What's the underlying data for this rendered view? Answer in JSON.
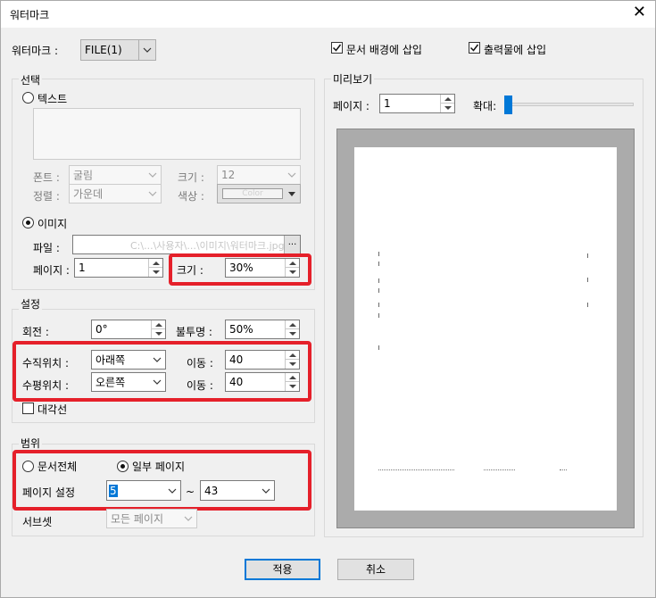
{
  "window": {
    "title": "워터마크",
    "close": "✕"
  },
  "watermark": {
    "label": "워터마크 :",
    "value": "FILE(1)"
  },
  "options": {
    "behind_text": "문서 배경에 삽입",
    "on_print": "출력물에 삽입",
    "behind_text_checked": true,
    "on_print_checked": true
  },
  "selection": {
    "title": "선택",
    "text_radio": "텍스트",
    "text_selected": false,
    "font_label": "폰트 :",
    "font_value": "굴림",
    "size_label": "크기 :",
    "size_value": "12",
    "align_label": "정렬 :",
    "align_value": "가운데",
    "color_label": "색상 :",
    "color_value": "Color",
    "image_radio": "이미지",
    "image_selected": true,
    "file_label": "파일 :",
    "file_value": "C:\\...\\사용자\\...\\이미지\\워터마크.jpg",
    "browse": "...",
    "page_label": "페이지 :",
    "page_value": "1",
    "scale_label": "크기 :",
    "scale_value": "30%"
  },
  "settings": {
    "title": "설정",
    "rotation_label": "회전 :",
    "rotation_value": "0°",
    "opacity_label": "불투명 :",
    "opacity_value": "50%",
    "vertical_label": "수직위치 :",
    "vertical_value": "아래쪽",
    "vshift_label": "이동 :",
    "vshift_value": "40",
    "horizontal_label": "수평위치 :",
    "horizontal_value": "오른쪽",
    "hshift_label": "이동 :",
    "hshift_value": "40",
    "diagonal_label": "대각선",
    "diagonal_checked": false
  },
  "range": {
    "title": "범위",
    "all_radio": "문서전체",
    "partial_radio": "일부 페이지",
    "partial_selected": true,
    "page_setting_label": "페이지 설정",
    "from_value": "5",
    "tilde": "~",
    "to_value": "43",
    "subset_label": "서브셋",
    "subset_value": "모든 페이지"
  },
  "preview": {
    "title": "미리보기",
    "page_label": "페이지 :",
    "page_value": "1",
    "zoom_label": "확대:",
    "zoom_level": 0
  },
  "buttons": {
    "apply": "적용",
    "cancel": "취소"
  },
  "colors": {
    "highlight": "#e5202a",
    "accent": "#0078d7"
  }
}
